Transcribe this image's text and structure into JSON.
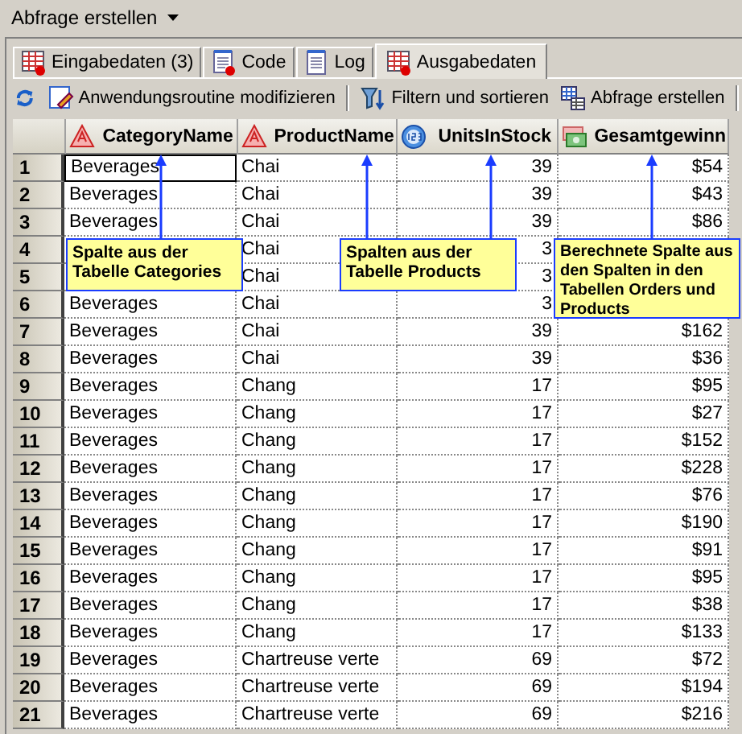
{
  "menu": {
    "label": "Abfrage erstellen"
  },
  "tabs": [
    {
      "label": "Eingabedaten (3)",
      "kind": "data",
      "selected": false
    },
    {
      "label": "Code",
      "kind": "code",
      "selected": false
    },
    {
      "label": "Log",
      "kind": "log",
      "selected": false
    },
    {
      "label": "Ausgabedaten",
      "kind": "data",
      "selected": true
    }
  ],
  "toolbar": [
    {
      "kind": "refresh"
    },
    {
      "kind": "edit",
      "label": "Anwendungsroutine modifizieren"
    },
    {
      "kind": "separator"
    },
    {
      "kind": "filter",
      "label": "Filtern und sortieren"
    },
    {
      "kind": "query",
      "label": "Abfrage erstellen"
    },
    {
      "kind": "separator"
    }
  ],
  "table": {
    "columns": [
      {
        "label": "CategoryName",
        "kind": "character"
      },
      {
        "label": "ProductName",
        "kind": "character"
      },
      {
        "label": "UnitsInStock",
        "kind": "numeric"
      },
      {
        "label": "Gesamtgewinn",
        "kind": "currency"
      }
    ],
    "rows": [
      {
        "number": "1",
        "focused": true,
        "category": "Beverages",
        "product": "Chai",
        "units": "39",
        "profit": "$54"
      },
      {
        "number": "2",
        "focused": false,
        "category": "Beverages",
        "product": "Chai",
        "units": "39",
        "profit": "$43"
      },
      {
        "number": "3",
        "focused": false,
        "category": "Beverages",
        "product": "Chai",
        "units": "39",
        "profit": "$86"
      },
      {
        "number": "4",
        "focused": false,
        "product": "Chai",
        "units": "3"
      },
      {
        "number": "5",
        "focused": false,
        "product": "Chai",
        "units": "3"
      },
      {
        "number": "6",
        "focused": false,
        "category": "Beverages",
        "product": "Chai",
        "units": "3"
      },
      {
        "number": "7",
        "focused": false,
        "category": "Beverages",
        "product": "Chai",
        "units": "39",
        "profit": "$162"
      },
      {
        "number": "8",
        "focused": false,
        "category": "Beverages",
        "product": "Chai",
        "units": "39",
        "profit": "$36"
      },
      {
        "number": "9",
        "focused": false,
        "category": "Beverages",
        "product": "Chang",
        "units": "17",
        "profit": "$95"
      },
      {
        "number": "10",
        "focused": false,
        "category": "Beverages",
        "product": "Chang",
        "units": "17",
        "profit": "$27"
      },
      {
        "number": "11",
        "focused": false,
        "category": "Beverages",
        "product": "Chang",
        "units": "17",
        "profit": "$152"
      },
      {
        "number": "12",
        "focused": false,
        "category": "Beverages",
        "product": "Chang",
        "units": "17",
        "profit": "$228"
      },
      {
        "number": "13",
        "focused": false,
        "category": "Beverages",
        "product": "Chang",
        "units": "17",
        "profit": "$76"
      },
      {
        "number": "14",
        "focused": false,
        "category": "Beverages",
        "product": "Chang",
        "units": "17",
        "profit": "$190"
      },
      {
        "number": "15",
        "focused": false,
        "category": "Beverages",
        "product": "Chang",
        "units": "17",
        "profit": "$91"
      },
      {
        "number": "16",
        "focused": false,
        "category": "Beverages",
        "product": "Chang",
        "units": "17",
        "profit": "$95"
      },
      {
        "number": "17",
        "focused": false,
        "category": "Beverages",
        "product": "Chang",
        "units": "17",
        "profit": "$38"
      },
      {
        "number": "18",
        "focused": false,
        "category": "Beverages",
        "product": "Chang",
        "units": "17",
        "profit": "$133"
      },
      {
        "number": "19",
        "focused": false,
        "category": "Beverages",
        "product": "Chartreuse verte",
        "units": "69",
        "profit": "$72"
      },
      {
        "number": "20",
        "focused": false,
        "category": "Beverages",
        "product": "Chartreuse verte",
        "units": "69",
        "profit": "$194"
      },
      {
        "number": "21",
        "focused": false,
        "category": "Beverages",
        "product": "Chartreuse verte",
        "units": "69",
        "profit": "$216"
      }
    ]
  },
  "callouts": [
    "Spalte aus der Tabelle Categories",
    "Spalten aus der Tabelle Products",
    "Berechnete Spalte aus den Spalten in den Tabellen Orders und Products"
  ]
}
